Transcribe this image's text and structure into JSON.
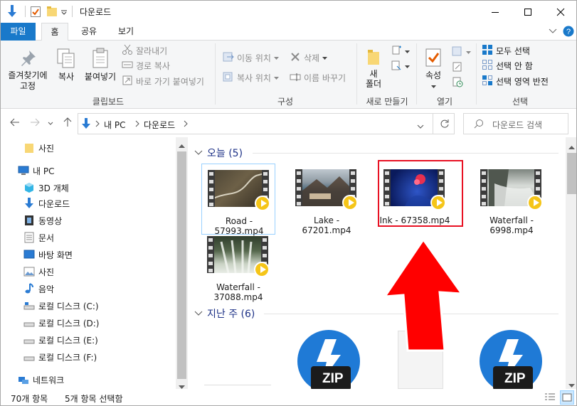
{
  "window": {
    "title": "다운로드"
  },
  "tabs": {
    "file": "파일",
    "home": "홈",
    "share": "공유",
    "view": "보기"
  },
  "ribbon": {
    "pin": "즐겨찾기에\n고정",
    "copy": "복사",
    "paste": "붙여넣기",
    "cut": "잘라내기",
    "copy_path": "경로 복사",
    "paste_shortcut": "바로 가기 붙여넣기",
    "clipboard_group": "클립보드",
    "move_to": "이동 위치",
    "copy_to": "복사 위치",
    "delete": "삭제",
    "rename": "이름 바꾸기",
    "organize_group": "구성",
    "new_folder": "새\n폴더",
    "new_group": "새로 만들기",
    "properties": "속성",
    "open_group": "열기",
    "select_all": "모두 선택",
    "select_none": "선택 안 함",
    "invert_selection": "선택 영역 반전",
    "select_group": "선택"
  },
  "address": {
    "crumbs": [
      "내 PC",
      "다운로드"
    ],
    "search_placeholder": "다운로드 검색"
  },
  "nav": {
    "items": [
      {
        "label": "사진",
        "icon": "folder-icon"
      },
      {
        "label": "내 PC",
        "icon": "pc-icon"
      },
      {
        "label": "3D 개체",
        "icon": "3d-objects-icon"
      },
      {
        "label": "다운로드",
        "icon": "download-icon"
      },
      {
        "label": "동영상",
        "icon": "video-icon"
      },
      {
        "label": "문서",
        "icon": "document-icon"
      },
      {
        "label": "바탕 화면",
        "icon": "desktop-icon"
      },
      {
        "label": "사진",
        "icon": "pictures-icon"
      },
      {
        "label": "음악",
        "icon": "music-icon"
      },
      {
        "label": "로컬 디스크 (C:)",
        "icon": "drive-icon"
      },
      {
        "label": "로컬 디스크 (D:)",
        "icon": "drive-icon"
      },
      {
        "label": "로컬 디스크 (E:)",
        "icon": "drive-icon"
      },
      {
        "label": "로컬 디스크 (F:)",
        "icon": "drive-icon"
      },
      {
        "label": "네트워크",
        "icon": "network-icon"
      }
    ]
  },
  "groups": {
    "today": "오늘 (5)",
    "last_week": "지난 주 (6)"
  },
  "files": [
    {
      "name": "Road -\n57993.mp4",
      "theme": "road"
    },
    {
      "name": "Lake -\n67201.mp4",
      "theme": "lake"
    },
    {
      "name": "Ink - 67358.mp4",
      "theme": "ink"
    },
    {
      "name": "Waterfall -\n6998.mp4",
      "theme": "waterfall"
    },
    {
      "name": "Waterfall -\n37088.mp4",
      "theme": "waterfall2"
    }
  ],
  "zip_label": "ZIP",
  "status": {
    "count": "70개 항목",
    "selected": "5개 항목 선택함"
  },
  "colors": {
    "accent": "#1979ca",
    "highlight": "#e81123",
    "arrow": "#ff0000",
    "play": "#f5c518"
  }
}
